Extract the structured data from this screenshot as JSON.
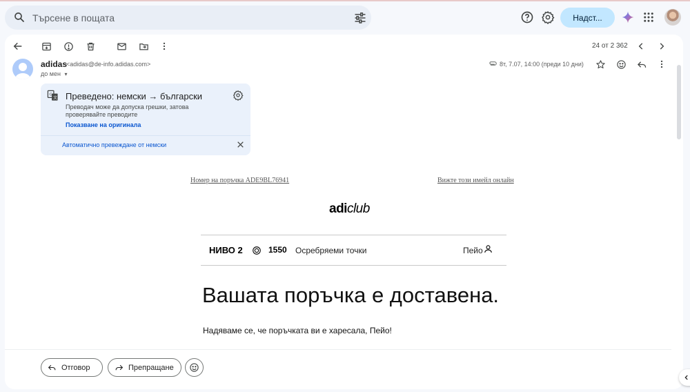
{
  "search": {
    "placeholder": "Търсене в пощата"
  },
  "header": {
    "upgrade_label": "Надст..."
  },
  "toolbar": {
    "counter": "24 от 2 362"
  },
  "message": {
    "sender_name": "adidas",
    "sender_email": "<adidas@de-info.adidas.com>",
    "to_label": "до мен",
    "date": "8т, 7.07, 14:00 (преди 10 дни)"
  },
  "translation": {
    "title": "Преведено: немски → български",
    "description": "Преводач може да допуска грешки, затова проверявайте преводите",
    "show_original": "Показване на оригинала",
    "auto_translate": "Автоматично превеждане от немски"
  },
  "email": {
    "order_link": "Номер на поръчка ADE9BL76941",
    "online_link": "Вижте този имейл онлайн",
    "logo_adi": "adi",
    "logo_club": "club",
    "level_label": "НИВО",
    "level_value": "2",
    "points_value": "1550",
    "points_label": "Осребряеми точки",
    "user_name": "Пейо",
    "headline": "Вашата поръчка е доставена.",
    "body": "Надяваме се, че поръчката ви е харесала, Пейо!"
  },
  "actions": {
    "reply_label": "Отговор",
    "forward_label": "Препращане"
  },
  "colors": {
    "accent": "#0b57d0",
    "upgrade_bg": "#c2e7ff",
    "translation_bg": "#eaf1fb"
  }
}
